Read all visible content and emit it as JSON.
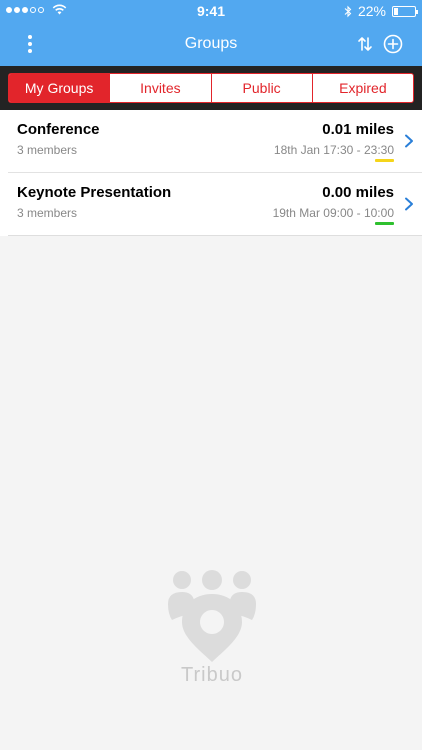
{
  "status_bar": {
    "time": "9:41",
    "battery_text": "22%",
    "battery_level": 0.22,
    "signal_bars_filled": 3,
    "signal_bars_total": 5
  },
  "nav": {
    "title": "Groups",
    "menu_icon": "more-vertical-icon",
    "sort_icon": "sort-arrows-icon",
    "add_icon": "add-circle-icon"
  },
  "tabs": [
    {
      "label": "My Groups",
      "active": true
    },
    {
      "label": "Invites",
      "active": false
    },
    {
      "label": "Public",
      "active": false
    },
    {
      "label": "Expired",
      "active": false
    }
  ],
  "groups": [
    {
      "name": "Conference",
      "members": "3 members",
      "distance": "0.01 miles",
      "time": "18th Jan 17:30 - 23:30",
      "indicator_color": "#f5d51a"
    },
    {
      "name": "Keynote Presentation",
      "members": "3 members",
      "distance": "0.00 miles",
      "time": "19th Mar 09:00 - 10:00",
      "indicator_color": "#2ec02e"
    }
  ],
  "watermark": {
    "text": "Tribuo"
  },
  "colors": {
    "primary": "#52a8f0",
    "accent": "#e2252b",
    "chevron": "#2a7fd8"
  }
}
